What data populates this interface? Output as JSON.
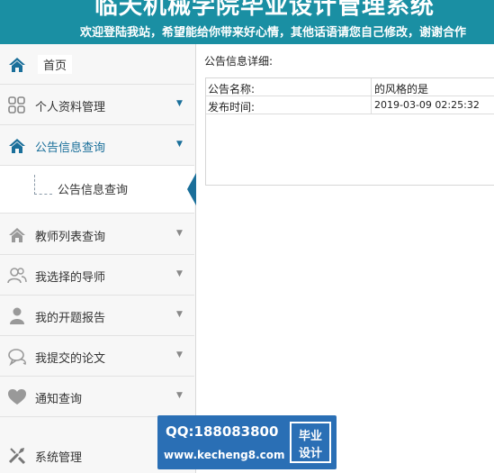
{
  "header": {
    "title": "临夭机械学院毕业设计管理系统",
    "marquee": "欢迎登陆我站，希望能给你带来好心情，其他话语请您自己修改，谢谢合作"
  },
  "sidebar": {
    "items": [
      {
        "label": "首页",
        "icon": "home-icon"
      },
      {
        "label": "个人资料管理",
        "icon": "grid-icon"
      },
      {
        "label": "公告信息查询",
        "icon": "home-icon",
        "active": true
      },
      {
        "label": "教师列表查询",
        "icon": "home-icon"
      },
      {
        "label": "我选择的导师",
        "icon": "users-icon"
      },
      {
        "label": "我的开题报告",
        "icon": "user-icon"
      },
      {
        "label": "我提交的论文",
        "icon": "chat-icon"
      },
      {
        "label": "通知查询",
        "icon": "heart-icon"
      },
      {
        "label": "系统管理",
        "icon": "tools-icon"
      }
    ],
    "sub_items": [
      {
        "label": "公告信息查询"
      }
    ]
  },
  "main": {
    "panel_title": "公告信息详细:",
    "fields": [
      {
        "key": "公告名称:",
        "value": "的风格的是"
      },
      {
        "key": "发布时间:",
        "value": "2019-03-09 02:25:32"
      }
    ]
  },
  "watermark": {
    "qq": "QQ:188083800",
    "url": "www.kecheng8.com",
    "seal_line1": "毕业",
    "seal_line2": "设计"
  },
  "colors": {
    "header_bg": "#1a8fa3",
    "active_accent": "#1a6f9a",
    "watermark_bg": "#2a6fb5"
  }
}
